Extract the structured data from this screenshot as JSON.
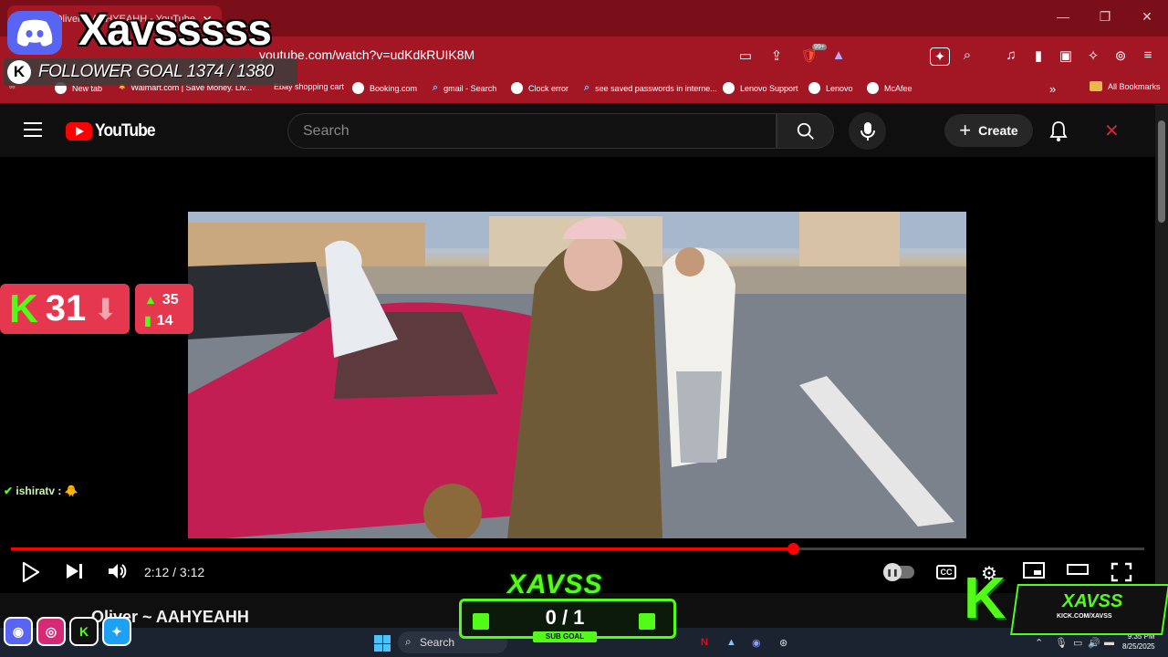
{
  "browser": {
    "tab_title": "Oliver ~ AAHYEAHH - YouTube",
    "url": "youtube.com/watch?v=udKdkRUIK8M",
    "brave_badge": "99+",
    "bookmarks": [
      "New tab",
      "Walmart.com | Save Money. Liv...",
      "Ebay shopping cart",
      "Booking.com",
      "gmail - Search",
      "Clock error",
      "see saved passwords in interne...",
      "Lenovo Support",
      "Lenovo",
      "McAfee"
    ],
    "all_bookmarks": "All Bookmarks"
  },
  "youtube": {
    "logo_text": "YouTube",
    "search_placeholder": "Search",
    "create_label": "Create",
    "time_display": "2:12 / 3:12",
    "progress_fraction": 0.69,
    "cc_label": "CC",
    "video_title": "Oliver ~ AAHYEAHH"
  },
  "overlay": {
    "streamer_name": "Xavsssss",
    "follower_goal": "FOLLOWER GOAL 1374 / 1380",
    "kick_letter": "K",
    "rank": "31",
    "stat_up": "35",
    "stat_bars": "14",
    "chat_user": "ishiratv",
    "chat_sep": " : ",
    "chat_msg": "🐥",
    "subgoal_title": "XAVSS",
    "subgoal_count": "0 / 1",
    "subgoal_label": "SUB GOAL",
    "brand_name": "XAVSS",
    "brand_url": "KICK.COM/XAVSS"
  },
  "taskbar": {
    "search_label": "Search",
    "time": "9:35 PM",
    "date": "8/25/2025"
  },
  "colors": {
    "browser_red": "#a31725",
    "kick_green": "#53fc18",
    "yt_red": "#ff0000"
  }
}
